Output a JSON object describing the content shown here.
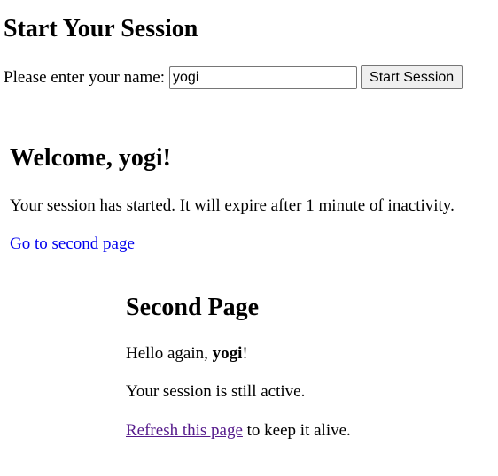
{
  "start_section": {
    "title": "Start Your Session",
    "name_label": "Please enter your name:",
    "name_value": "yogi",
    "submit_label": "Start Session"
  },
  "welcome_section": {
    "greeting_prefix": "Welcome, ",
    "user_name": "yogi",
    "greeting_suffix": "!",
    "message": "Your session has started. It will expire after 1 minute of inactivity.",
    "link_label": "Go to second page"
  },
  "second_section": {
    "title": "Second Page",
    "hello_prefix": "Hello again, ",
    "user_name": "yogi",
    "hello_suffix": "!",
    "status": "Your session is still active.",
    "refresh_link_label": "Refresh this page",
    "refresh_suffix": " to keep it alive."
  },
  "colors": {
    "link": "#0000ee",
    "visited_link": "#551a8b",
    "button_bg": "#efefef"
  }
}
